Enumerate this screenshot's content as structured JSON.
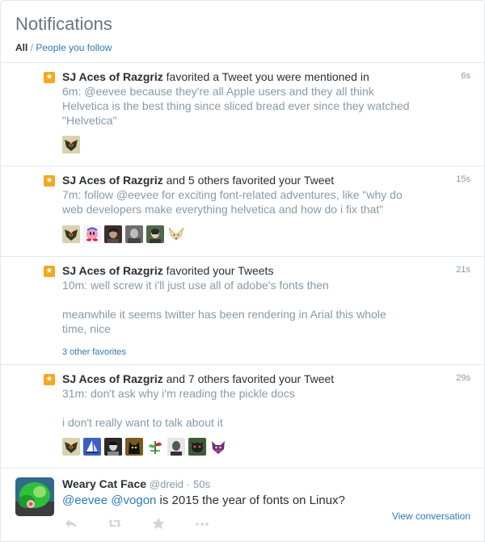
{
  "header": {
    "title": "Notifications",
    "filter_all": "All",
    "filter_sep": "/",
    "filter_following": "People you follow"
  },
  "notifications": [
    {
      "name": "SJ Aces of Razgriz",
      "action": "favorited a Tweet you were mentioned in",
      "time": "6s",
      "text_prefix": "6m: ",
      "mention": "@eevee",
      "text_rest": " because they're all Apple users and they all think Helvetica is the best thing since sliced bread ever since they watched \"Helvetica\"",
      "avatars": [
        "razgriz-emblem"
      ]
    },
    {
      "name": "SJ Aces of Razgriz",
      "action": "and 5 others favorited your Tweet",
      "time": "15s",
      "text_prefix": "7m: follow ",
      "mention": "@eevee",
      "text_rest": " for exciting font-related adventures, like \"why do web developers make everything helvetica and how do i fix that\"",
      "avatars": [
        "razgriz-emblem",
        "kirby",
        "person-dark",
        "person-gray",
        "person-green",
        "fennec"
      ]
    },
    {
      "name": "SJ Aces of Razgriz",
      "action": "favorited your Tweets",
      "time": "21s",
      "text_line1": "10m: well screw it i'll just use all of adobe's fonts then",
      "text_line2": "meanwhile it seems twitter has been rendering in Arial this whole time, nice",
      "more": "3 other favorites"
    },
    {
      "name": "SJ Aces of Razgriz",
      "action": "and 7 others favorited your Tweet",
      "time": "29s",
      "text_line1": "31m: don't ask why i'm reading the pickle docs",
      "text_line2": "i don't really want to talk about it",
      "avatars": [
        "razgriz-emblem",
        "blue-sail",
        "person-bw",
        "black-cat",
        "green-plant",
        "person-mono",
        "dark-creature",
        "purple-creature"
      ]
    }
  ],
  "tweet": {
    "name": "Weary Cat Face",
    "handle": "@dreid",
    "dot": "·",
    "time": "50s",
    "mention1": "@eevee",
    "mention2": "@vogon",
    "text_rest": " is 2015 the year of fonts on Linux?",
    "view_conversation": "View conversation",
    "actions": [
      "reply-icon",
      "retweet-icon",
      "favorite-icon",
      "more-icon"
    ]
  },
  "colors": {
    "accent": "#2b7bb9",
    "star": "#f6a623",
    "muted": "#8899a6",
    "border": "#e1e8ed"
  }
}
